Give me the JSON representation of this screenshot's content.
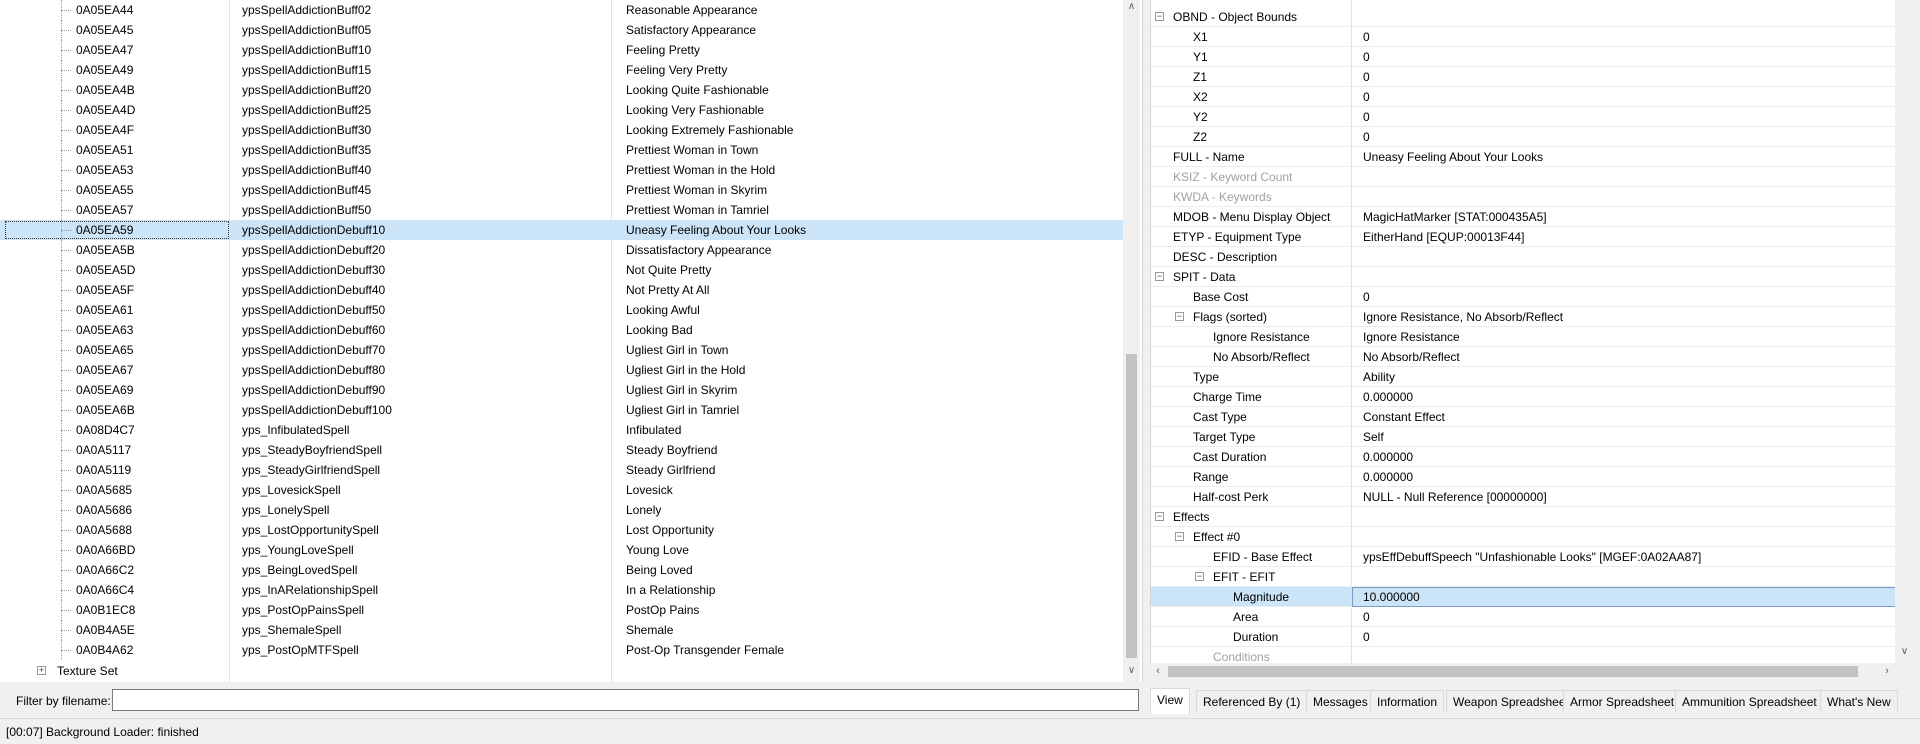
{
  "left_list": {
    "rows": [
      {
        "id": "0A05EA44",
        "edid": "ypsSpellAddictionBuff02",
        "name": "Reasonable Appearance"
      },
      {
        "id": "0A05EA45",
        "edid": "ypsSpellAddictionBuff05",
        "name": "Satisfactory Appearance"
      },
      {
        "id": "0A05EA47",
        "edid": "ypsSpellAddictionBuff10",
        "name": "Feeling Pretty"
      },
      {
        "id": "0A05EA49",
        "edid": "ypsSpellAddictionBuff15",
        "name": "Feeling Very Pretty"
      },
      {
        "id": "0A05EA4B",
        "edid": "ypsSpellAddictionBuff20",
        "name": "Looking Quite Fashionable"
      },
      {
        "id": "0A05EA4D",
        "edid": "ypsSpellAddictionBuff25",
        "name": "Looking Very Fashionable"
      },
      {
        "id": "0A05EA4F",
        "edid": "ypsSpellAddictionBuff30",
        "name": "Looking Extremely Fashionable"
      },
      {
        "id": "0A05EA51",
        "edid": "ypsSpellAddictionBuff35",
        "name": "Prettiest Woman in Town"
      },
      {
        "id": "0A05EA53",
        "edid": "ypsSpellAddictionBuff40",
        "name": "Prettiest Woman in the Hold"
      },
      {
        "id": "0A05EA55",
        "edid": "ypsSpellAddictionBuff45",
        "name": "Prettiest Woman in Skyrim"
      },
      {
        "id": "0A05EA57",
        "edid": "ypsSpellAddictionBuff50",
        "name": "Prettiest Woman in Tamriel"
      },
      {
        "id": "0A05EA59",
        "edid": "ypsSpellAddictionDebuff10",
        "name": "Uneasy Feeling About Your Looks"
      },
      {
        "id": "0A05EA5B",
        "edid": "ypsSpellAddictionDebuff20",
        "name": "Dissatisfactory Appearance"
      },
      {
        "id": "0A05EA5D",
        "edid": "ypsSpellAddictionDebuff30",
        "name": "Not Quite Pretty"
      },
      {
        "id": "0A05EA5F",
        "edid": "ypsSpellAddictionDebuff40",
        "name": "Not Pretty At All"
      },
      {
        "id": "0A05EA61",
        "edid": "ypsSpellAddictionDebuff50",
        "name": "Looking Awful"
      },
      {
        "id": "0A05EA63",
        "edid": "ypsSpellAddictionDebuff60",
        "name": "Looking Bad"
      },
      {
        "id": "0A05EA65",
        "edid": "ypsSpellAddictionDebuff70",
        "name": "Ugliest Girl in Town"
      },
      {
        "id": "0A05EA67",
        "edid": "ypsSpellAddictionDebuff80",
        "name": "Ugliest Girl in the Hold"
      },
      {
        "id": "0A05EA69",
        "edid": "ypsSpellAddictionDebuff90",
        "name": "Ugliest Girl in Skyrim"
      },
      {
        "id": "0A05EA6B",
        "edid": "ypsSpellAddictionDebuff100",
        "name": "Ugliest Girl in Tamriel"
      },
      {
        "id": "0A08D4C7",
        "edid": "yps_InfibulatedSpell",
        "name": "Infibulated"
      },
      {
        "id": "0A0A5117",
        "edid": "yps_SteadyBoyfriendSpell",
        "name": "Steady Boyfriend"
      },
      {
        "id": "0A0A5119",
        "edid": "yps_SteadyGirlfriendSpell",
        "name": "Steady Girlfriend"
      },
      {
        "id": "0A0A5685",
        "edid": "yps_LovesickSpell",
        "name": "Lovesick"
      },
      {
        "id": "0A0A5686",
        "edid": "yps_LonelySpell",
        "name": "Lonely"
      },
      {
        "id": "0A0A5688",
        "edid": "yps_LostOpportunitySpell",
        "name": "Lost Opportunity"
      },
      {
        "id": "0A0A66BD",
        "edid": "yps_YoungLoveSpell",
        "name": "Young Love"
      },
      {
        "id": "0A0A66C2",
        "edid": "yps_BeingLovedSpell",
        "name": "Being Loved"
      },
      {
        "id": "0A0A66C4",
        "edid": "yps_InARelationshipSpell",
        "name": "In a Relationship"
      },
      {
        "id": "0A0B1EC8",
        "edid": "yps_PostOpPainsSpell",
        "name": "PostOp Pains"
      },
      {
        "id": "0A0B4A5E",
        "edid": "yps_ShemaleSpell",
        "name": "Shemale"
      },
      {
        "id": "0A0B4A62",
        "edid": "yps_PostOpMTFSpell",
        "name": "Post-Op Transgender Female"
      }
    ],
    "selected_index": 11,
    "footer_group": "Texture Set"
  },
  "filter": {
    "label": "Filter by filename:",
    "value": ""
  },
  "status": {
    "text": "[00:07] Background Loader: finished"
  },
  "record_view": {
    "rows": [
      {
        "label": "OBND - Object Bounds",
        "value": "",
        "depth": 0,
        "expander": "minus"
      },
      {
        "label": "X1",
        "value": "0",
        "depth": 1
      },
      {
        "label": "Y1",
        "value": "0",
        "depth": 1
      },
      {
        "label": "Z1",
        "value": "0",
        "depth": 1
      },
      {
        "label": "X2",
        "value": "0",
        "depth": 1
      },
      {
        "label": "Y2",
        "value": "0",
        "depth": 1
      },
      {
        "label": "Z2",
        "value": "0",
        "depth": 1
      },
      {
        "label": "FULL - Name",
        "value": "Uneasy Feeling About Your Looks",
        "depth": 0
      },
      {
        "label": "KSIZ - Keyword Count",
        "value": "",
        "depth": 0,
        "dim": true
      },
      {
        "label": "KWDA - Keywords",
        "value": "",
        "depth": 0,
        "dim": true
      },
      {
        "label": "MDOB - Menu Display Object",
        "value": "MagicHatMarker [STAT:000435A5]",
        "depth": 0
      },
      {
        "label": "ETYP - Equipment Type",
        "value": "EitherHand [EQUP:00013F44]",
        "depth": 0
      },
      {
        "label": "DESC - Description",
        "value": "",
        "depth": 0
      },
      {
        "label": "SPIT - Data",
        "value": "",
        "depth": 0,
        "expander": "minus"
      },
      {
        "label": "Base Cost",
        "value": "0",
        "depth": 1
      },
      {
        "label": "Flags (sorted)",
        "value": "Ignore Resistance, No Absorb/Reflect",
        "depth": 1,
        "expander": "minus"
      },
      {
        "label": "Ignore Resistance",
        "value": "Ignore Resistance",
        "depth": 2
      },
      {
        "label": "No Absorb/Reflect",
        "value": "No Absorb/Reflect",
        "depth": 2
      },
      {
        "label": "Type",
        "value": "Ability",
        "depth": 1
      },
      {
        "label": "Charge Time",
        "value": "0.000000",
        "depth": 1
      },
      {
        "label": "Cast Type",
        "value": "Constant Effect",
        "depth": 1
      },
      {
        "label": "Target Type",
        "value": "Self",
        "depth": 1
      },
      {
        "label": "Cast Duration",
        "value": "0.000000",
        "depth": 1
      },
      {
        "label": "Range",
        "value": "0.000000",
        "depth": 1
      },
      {
        "label": "Half-cost Perk",
        "value": "NULL - Null Reference [00000000]",
        "depth": 1
      },
      {
        "label": "Effects",
        "value": "",
        "depth": 0,
        "expander": "minus"
      },
      {
        "label": "Effect #0",
        "value": "",
        "depth": 1,
        "expander": "minus"
      },
      {
        "label": "EFID - Base Effect",
        "value": "ypsEffDebuffSpeech \"Unfashionable Looks\" [MGEF:0A02AA87]",
        "depth": 2
      },
      {
        "label": "EFIT - EFIT",
        "value": "",
        "depth": 2,
        "expander": "minus"
      },
      {
        "label": "Magnitude",
        "value": "10.000000",
        "depth": 3,
        "selected": true
      },
      {
        "label": "Area",
        "value": "0",
        "depth": 3
      },
      {
        "label": "Duration",
        "value": "0",
        "depth": 3
      },
      {
        "label": "Conditions",
        "value": "",
        "depth": 2,
        "dim": true
      }
    ]
  },
  "tabs": [
    {
      "label": "View",
      "active": true
    },
    {
      "label": "Referenced By (1)"
    },
    {
      "label": "Messages"
    },
    {
      "label": "Information"
    },
    {
      "label": "Weapon Spreadsheet"
    },
    {
      "label": "Armor Spreadsheet"
    },
    {
      "label": "Ammunition Spreadsheet"
    },
    {
      "label": "What's New"
    }
  ],
  "icons": {
    "expand": "plus-box-icon",
    "collapse": "minus-box-icon",
    "scroll_up": "chevron-up-icon",
    "scroll_down": "chevron-down-icon",
    "scroll_left": "chevron-left-icon",
    "scroll_right": "chevron-right-icon"
  },
  "colors": {
    "selection": "#cce4f7",
    "dim_text": "#a0a0a0"
  }
}
